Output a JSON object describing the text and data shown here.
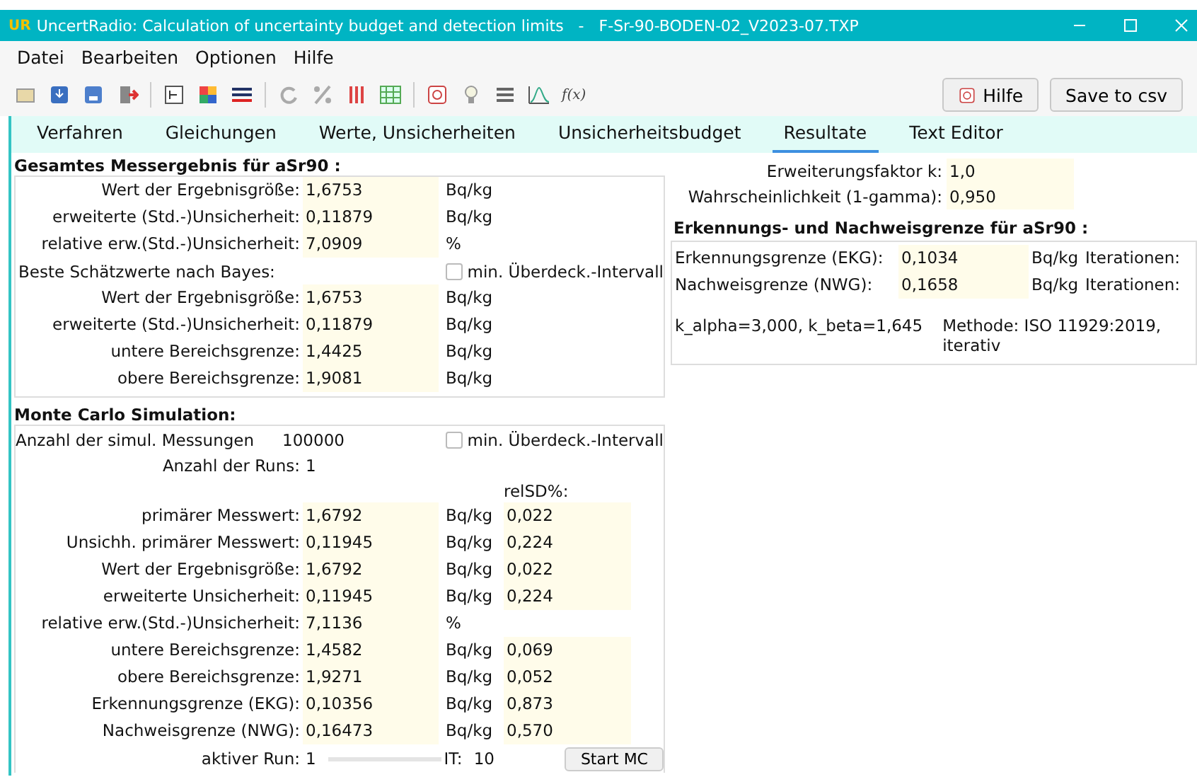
{
  "window": {
    "logo": "UR",
    "title": "UncertRadio: Calculation of uncertainty budget and detection limits   -   F-Sr-90-BODEN-02_V2023-07.TXP"
  },
  "menu": [
    "Datei",
    "Bearbeiten",
    "Optionen",
    "Hilfe"
  ],
  "toolbar": {
    "formula_label": "f(x)",
    "help_button": "Hilfe",
    "save_button": "Save to csv"
  },
  "tabs": [
    {
      "label": "Verfahren",
      "selected": false
    },
    {
      "label": "Gleichungen",
      "selected": false
    },
    {
      "label": "Werte, Unsicherheiten",
      "selected": false
    },
    {
      "label": "Unsicherheitsbudget",
      "selected": false
    },
    {
      "label": "Resultate",
      "selected": true
    },
    {
      "label": "Text Editor",
      "selected": false
    }
  ],
  "result": {
    "title": "Gesamtes Messergebnis für aSr90 :",
    "rows": [
      {
        "label": "Wert der Ergebnisgröße:",
        "value": "1,6753",
        "unit": "Bq/kg"
      },
      {
        "label": "erweiterte (Std.-)Unsicherheit:",
        "value": "0,11879",
        "unit": "Bq/kg"
      },
      {
        "label": "relative erw.(Std.-)Unsicherheit:",
        "value": "7,0909",
        "unit": "%"
      }
    ],
    "bayes_label": "Beste Schätzwerte nach Bayes:",
    "bayes_checkbox": {
      "label": "min. Überdeck.-Intervall",
      "checked": false
    },
    "bayes_rows": [
      {
        "label": "Wert der Ergebnisgröße:",
        "value": "1,6753",
        "unit": "Bq/kg"
      },
      {
        "label": "erweiterte (Std.-)Unsicherheit:",
        "value": "0,11879",
        "unit": "Bq/kg"
      },
      {
        "label": "untere Bereichsgrenze:",
        "value": "1,4425",
        "unit": "Bq/kg"
      },
      {
        "label": "obere Bereichsgrenze:",
        "value": "1,9081",
        "unit": "Bq/kg"
      }
    ]
  },
  "factors": [
    {
      "label": "Erweiterungsfaktor k:",
      "value": "1,0"
    },
    {
      "label": "Wahrscheinlichkeit (1-gamma):",
      "value": "0,950"
    }
  ],
  "detection": {
    "title": "Erkennungs- und Nachweisgrenze für aSr90 :",
    "rows": [
      {
        "label": "Erkennungsgrenze (EKG):",
        "value": "0,1034",
        "unit": "Bq/kg",
        "note": "Iterationen:"
      },
      {
        "label": "Nachweisgrenze (NWG):",
        "value": "0,1658",
        "unit": "Bq/kg",
        "note": "Iterationen:"
      }
    ],
    "k_values": "k_alpha=3,000,  k_beta=1,645",
    "method": "Methode: ISO 11929:2019, iterativ"
  },
  "monte_carlo": {
    "title": "Monte Carlo Simulation:",
    "count_label": "Anzahl der simul. Messungen",
    "count": "100000",
    "checkbox": {
      "label": "min. Überdeck.-Intervall",
      "checked": false
    },
    "runs_label": "Anzahl der Runs:",
    "runs": "1",
    "relsd_header": "relSD%:",
    "rows": [
      {
        "label": "primärer Messwert:",
        "value": "1,6792",
        "unit": "Bq/kg",
        "relsd": "0,022"
      },
      {
        "label": "Unsichh. primärer Messwert:",
        "value": "0,11945",
        "unit": "Bq/kg",
        "relsd": "0,224"
      },
      {
        "label": "Wert der Ergebnisgröße:",
        "value": "1,6792",
        "unit": "Bq/kg",
        "relsd": "0,022"
      },
      {
        "label": "erweiterte Unsicherheit:",
        "value": "0,11945",
        "unit": "Bq/kg",
        "relsd": "0,224"
      },
      {
        "label": "relative erw.(Std.-)Unsicherheit:",
        "value": "7,1136",
        "unit": "%"
      },
      {
        "label": "untere Bereichsgrenze:",
        "value": "1,4582",
        "unit": "Bq/kg",
        "relsd": "0,069"
      },
      {
        "label": "obere Bereichsgrenze:",
        "value": "1,9271",
        "unit": "Bq/kg",
        "relsd": "0,052"
      },
      {
        "label": "Erkennungsgrenze (EKG):",
        "value": "0,10356",
        "unit": "Bq/kg",
        "relsd": "0,873"
      },
      {
        "label": "Nachweisgrenze (NWG):",
        "value": "0,16473",
        "unit": "Bq/kg",
        "relsd": "0,570"
      }
    ],
    "active_label": "aktiver Run:",
    "active": "1",
    "it_label": "IT:",
    "it": "10",
    "start_button": "Start MC"
  }
}
